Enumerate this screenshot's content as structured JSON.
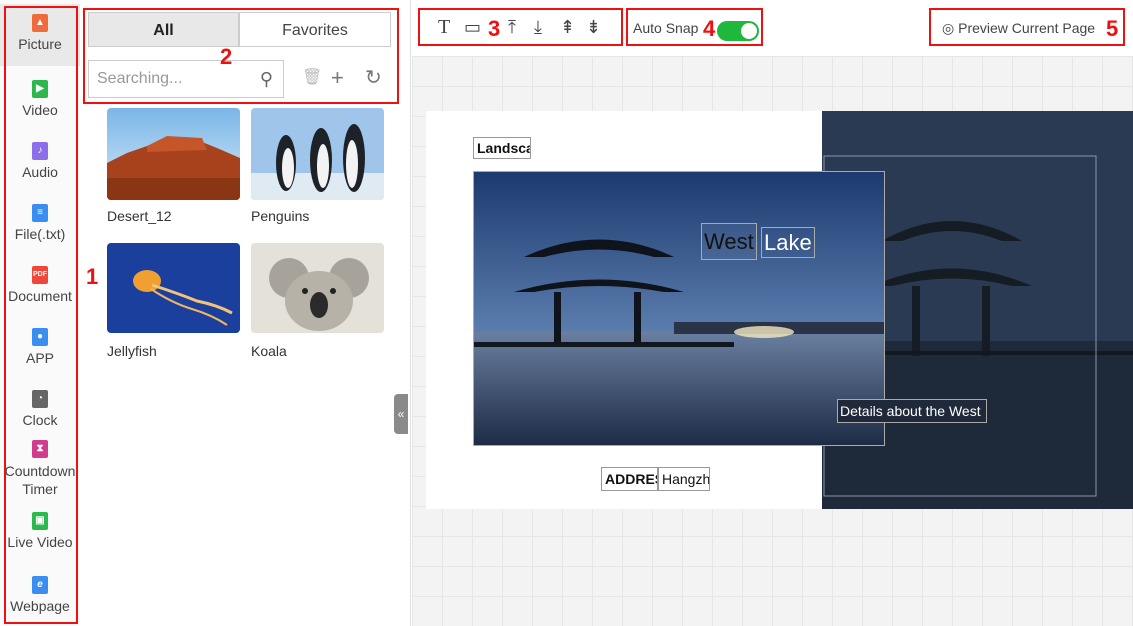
{
  "sidebar": {
    "items": [
      {
        "label": "Picture",
        "icon": "picture-icon",
        "color": "#f06b3c"
      },
      {
        "label": "Video",
        "icon": "video-icon",
        "color": "#2db84d"
      },
      {
        "label": "Audio",
        "icon": "audio-icon",
        "color": "#8c6ee8"
      },
      {
        "label": "File(.txt)",
        "icon": "file-icon",
        "color": "#3b8ef0"
      },
      {
        "label": "Document",
        "icon": "pdf-icon",
        "color": "#f0473c"
      },
      {
        "label": "APP",
        "icon": "android-icon",
        "color": "#3b8ef0"
      },
      {
        "label": "Clock",
        "icon": "clock-icon",
        "color": "#666666"
      },
      {
        "label": "Countdown Timer",
        "icon": "hourglass-icon",
        "color": "#d23c8c"
      },
      {
        "label": "Live Video",
        "icon": "live-video-icon",
        "color": "#2db84d"
      },
      {
        "label": "Webpage",
        "icon": "ie-icon",
        "color": "#3b8ef0"
      }
    ]
  },
  "media": {
    "tabs": [
      "All",
      "Favorites"
    ],
    "search_placeholder": "Searching...",
    "items": [
      {
        "name": "Desert_12"
      },
      {
        "name": "Penguins"
      },
      {
        "name": "Jellyfish"
      },
      {
        "name": "Koala"
      }
    ]
  },
  "toolbar": {
    "auto_snap_label": "Auto Snap",
    "auto_snap_on": true,
    "preview_label": "Preview Current Page"
  },
  "canvas": {
    "title_chip": "Landsca",
    "west": "West",
    "lake": "Lake",
    "details": "Details about the West",
    "address_label": "ADDRES",
    "address_value": "Hangzh"
  },
  "callouts": [
    "1",
    "2",
    "3",
    "4",
    "5"
  ]
}
